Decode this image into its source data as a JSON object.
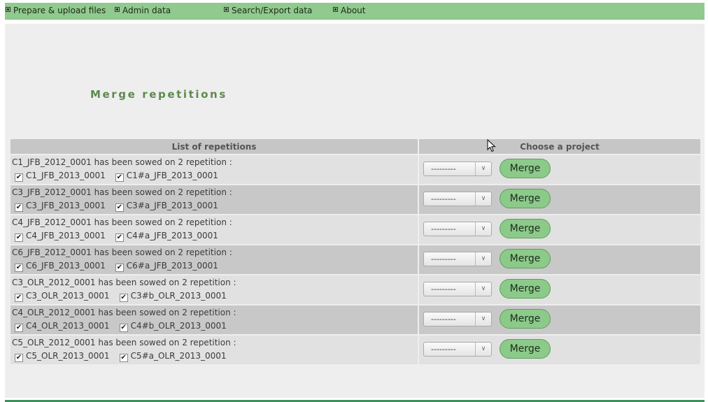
{
  "nav": {
    "items": [
      {
        "label": "Prepare & upload files"
      },
      {
        "label": "Admin data"
      },
      {
        "label": "Search/Export data"
      },
      {
        "label": "About"
      }
    ]
  },
  "page": {
    "title": "Merge repetitions"
  },
  "table": {
    "headers": [
      "List of repetitions",
      "Choose a project"
    ],
    "merge_label": "Merge",
    "select_value": "---------",
    "rows": [
      {
        "text": "C1_JFB_2012_0001 has been sowed on 2 repetition :",
        "checks": [
          "C1_JFB_2013_0001",
          "C1#a_JFB_2013_0001"
        ]
      },
      {
        "text": "C3_JFB_2012_0001 has been sowed on 2 repetition :",
        "checks": [
          "C3_JFB_2013_0001",
          "C3#a_JFB_2013_0001"
        ]
      },
      {
        "text": "C4_JFB_2012_0001 has been sowed on 2 repetition :",
        "checks": [
          "C4_JFB_2013_0001",
          "C4#a_JFB_2013_0001"
        ]
      },
      {
        "text": "C6_JFB_2012_0001 has been sowed on 2 repetition :",
        "checks": [
          "C6_JFB_2013_0001",
          "C6#a_JFB_2013_0001"
        ]
      },
      {
        "text": "C3_OLR_2012_0001 has been sowed on 2 repetition :",
        "checks": [
          "C3_OLR_2013_0001",
          "C3#b_OLR_2013_0001"
        ]
      },
      {
        "text": "C4_OLR_2012_0001 has been sowed on 2 repetition :",
        "checks": [
          "C4_OLR_2013_0001",
          "C4#b_OLR_2013_0001"
        ]
      },
      {
        "text": "C5_OLR_2012_0001 has been sowed on 2 repetition :",
        "checks": [
          "C5_OLR_2013_0001",
          "C5#a_OLR_2013_0001"
        ]
      }
    ]
  },
  "colors": {
    "nav_bg": "#91ca8e",
    "title": "#5c8a4f",
    "button": "#8cca8a",
    "row_light": "#e1e1e1",
    "row_dark": "#c8c8c8"
  }
}
